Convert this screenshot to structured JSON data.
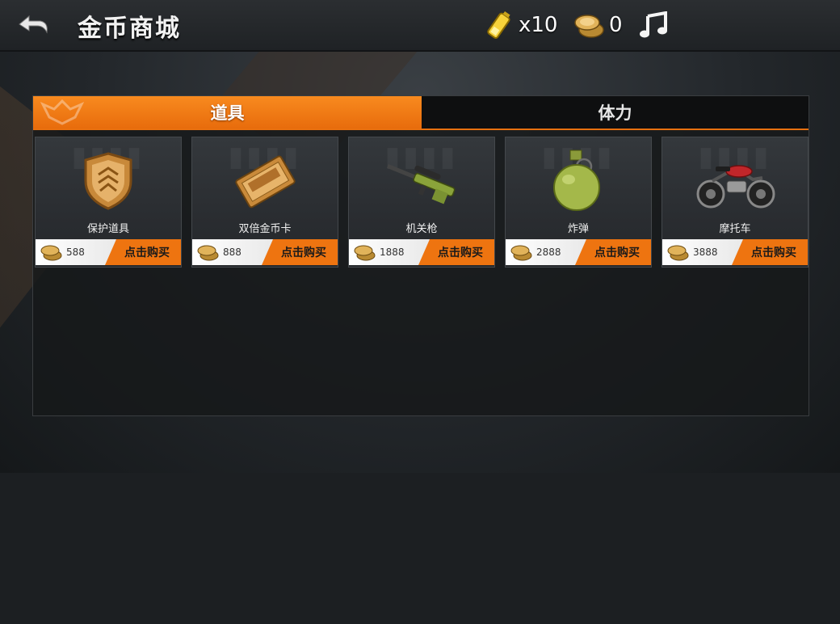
{
  "header": {
    "title": "金币商城",
    "energy_count": "x10",
    "coin_count": "0"
  },
  "tabs": [
    {
      "label": "道具",
      "active": true
    },
    {
      "label": "体力",
      "active": false
    }
  ],
  "items": [
    {
      "name": "保护道具",
      "price": "588",
      "buy_label": "点击购买",
      "icon": "shield-badge-icon"
    },
    {
      "name": "双倍金币卡",
      "price": "888",
      "buy_label": "点击购买",
      "icon": "double-coin-card-icon"
    },
    {
      "name": "机关枪",
      "price": "1888",
      "buy_label": "点击购买",
      "icon": "sniper-rifle-icon"
    },
    {
      "name": "炸弹",
      "price": "2888",
      "buy_label": "点击购买",
      "icon": "grenade-icon"
    },
    {
      "name": "摩托车",
      "price": "3888",
      "buy_label": "点击购买",
      "icon": "motorcycle-icon"
    }
  ],
  "colors": {
    "accent": "#ee7410",
    "tab_active": "#f88a1f",
    "panel_bg": "#16181a"
  }
}
